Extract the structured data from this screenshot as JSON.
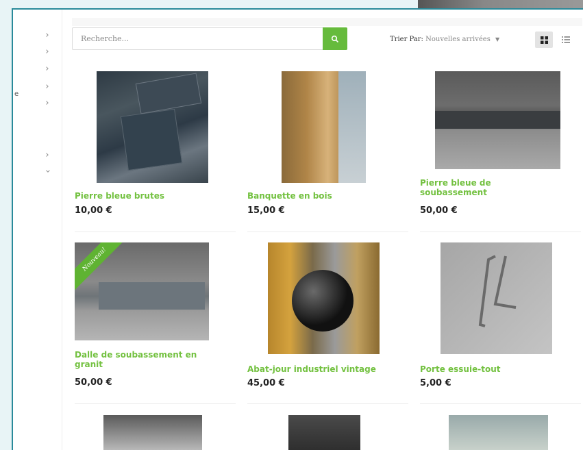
{
  "search": {
    "placeholder": "Recherche..."
  },
  "sort": {
    "label": "Trier Par:",
    "value": "Nouvelles arrivées"
  },
  "sidebar": {
    "partial_text": "e"
  },
  "products": [
    {
      "title": "Pierre bleue brutes",
      "price": "10,00 €",
      "badge": ""
    },
    {
      "title": "Banquette en bois",
      "price": "15,00 €",
      "badge": ""
    },
    {
      "title": "Pierre bleue de soubassement",
      "price": "50,00 €",
      "badge": ""
    },
    {
      "title": "Dalle de soubassement en granit",
      "price": "50,00 €",
      "badge": "Nouveau!"
    },
    {
      "title": "Abat-jour industriel vintage",
      "price": "45,00 €",
      "badge": ""
    },
    {
      "title": "Porte essuie-tout",
      "price": "5,00 €",
      "badge": ""
    }
  ],
  "colors": {
    "accent": "#66bb3c",
    "title_green": "#73c140",
    "frame": "#2a8a9a"
  },
  "icons": {
    "search": "search-icon",
    "grid": "grid-view-icon",
    "list": "list-view-icon",
    "chevron": "chevron-right-icon"
  }
}
